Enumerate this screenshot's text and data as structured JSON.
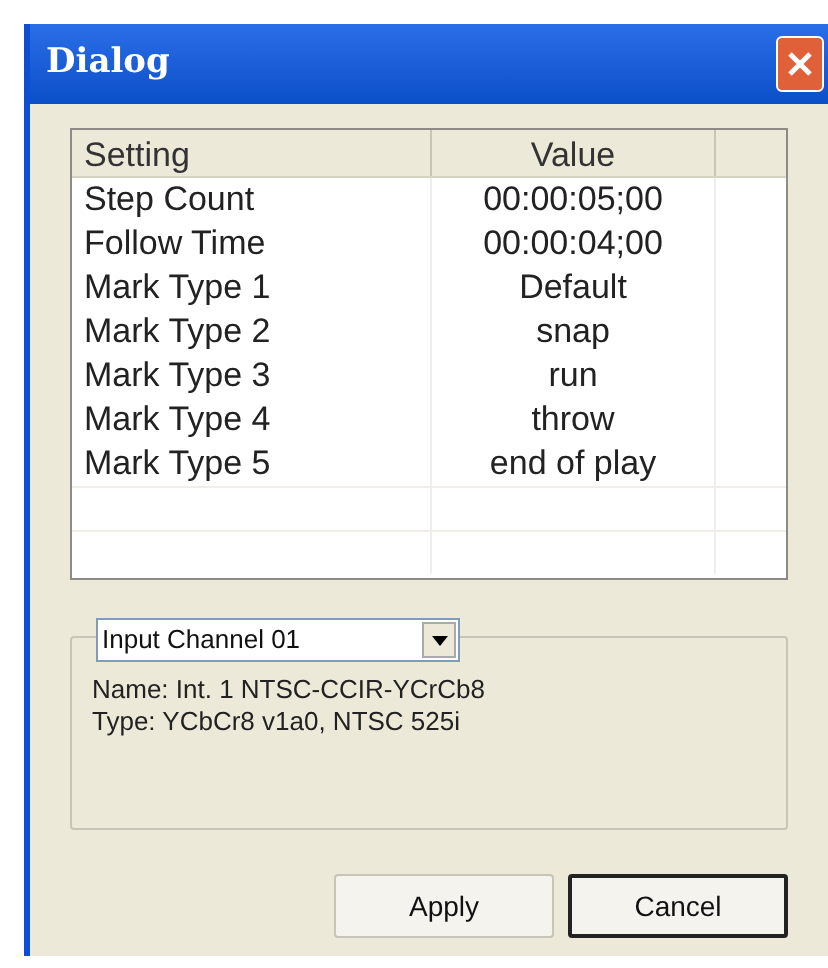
{
  "window": {
    "title": "Dialog"
  },
  "table": {
    "columns": [
      "Setting",
      "Value"
    ],
    "rows": [
      {
        "setting": "Step Count",
        "value": "00:00:05;00"
      },
      {
        "setting": "Follow Time",
        "value": "00:00:04;00"
      },
      {
        "setting": "Mark Type 1",
        "value": "Default"
      },
      {
        "setting": "Mark Type 2",
        "value": "snap"
      },
      {
        "setting": "Mark Type 3",
        "value": "run"
      },
      {
        "setting": "Mark Type 4",
        "value": "throw"
      },
      {
        "setting": "Mark Type 5",
        "value": "end of play"
      }
    ]
  },
  "channel": {
    "selected": "Input Channel 01",
    "lines": [
      "Name: Int. 1 NTSC-CCIR-YCrCb8",
      "Type: YCbCr8 v1a0, NTSC 525i"
    ]
  },
  "buttons": [
    {
      "label": "Apply",
      "default": false
    },
    {
      "label": "Cancel",
      "default": true
    }
  ]
}
